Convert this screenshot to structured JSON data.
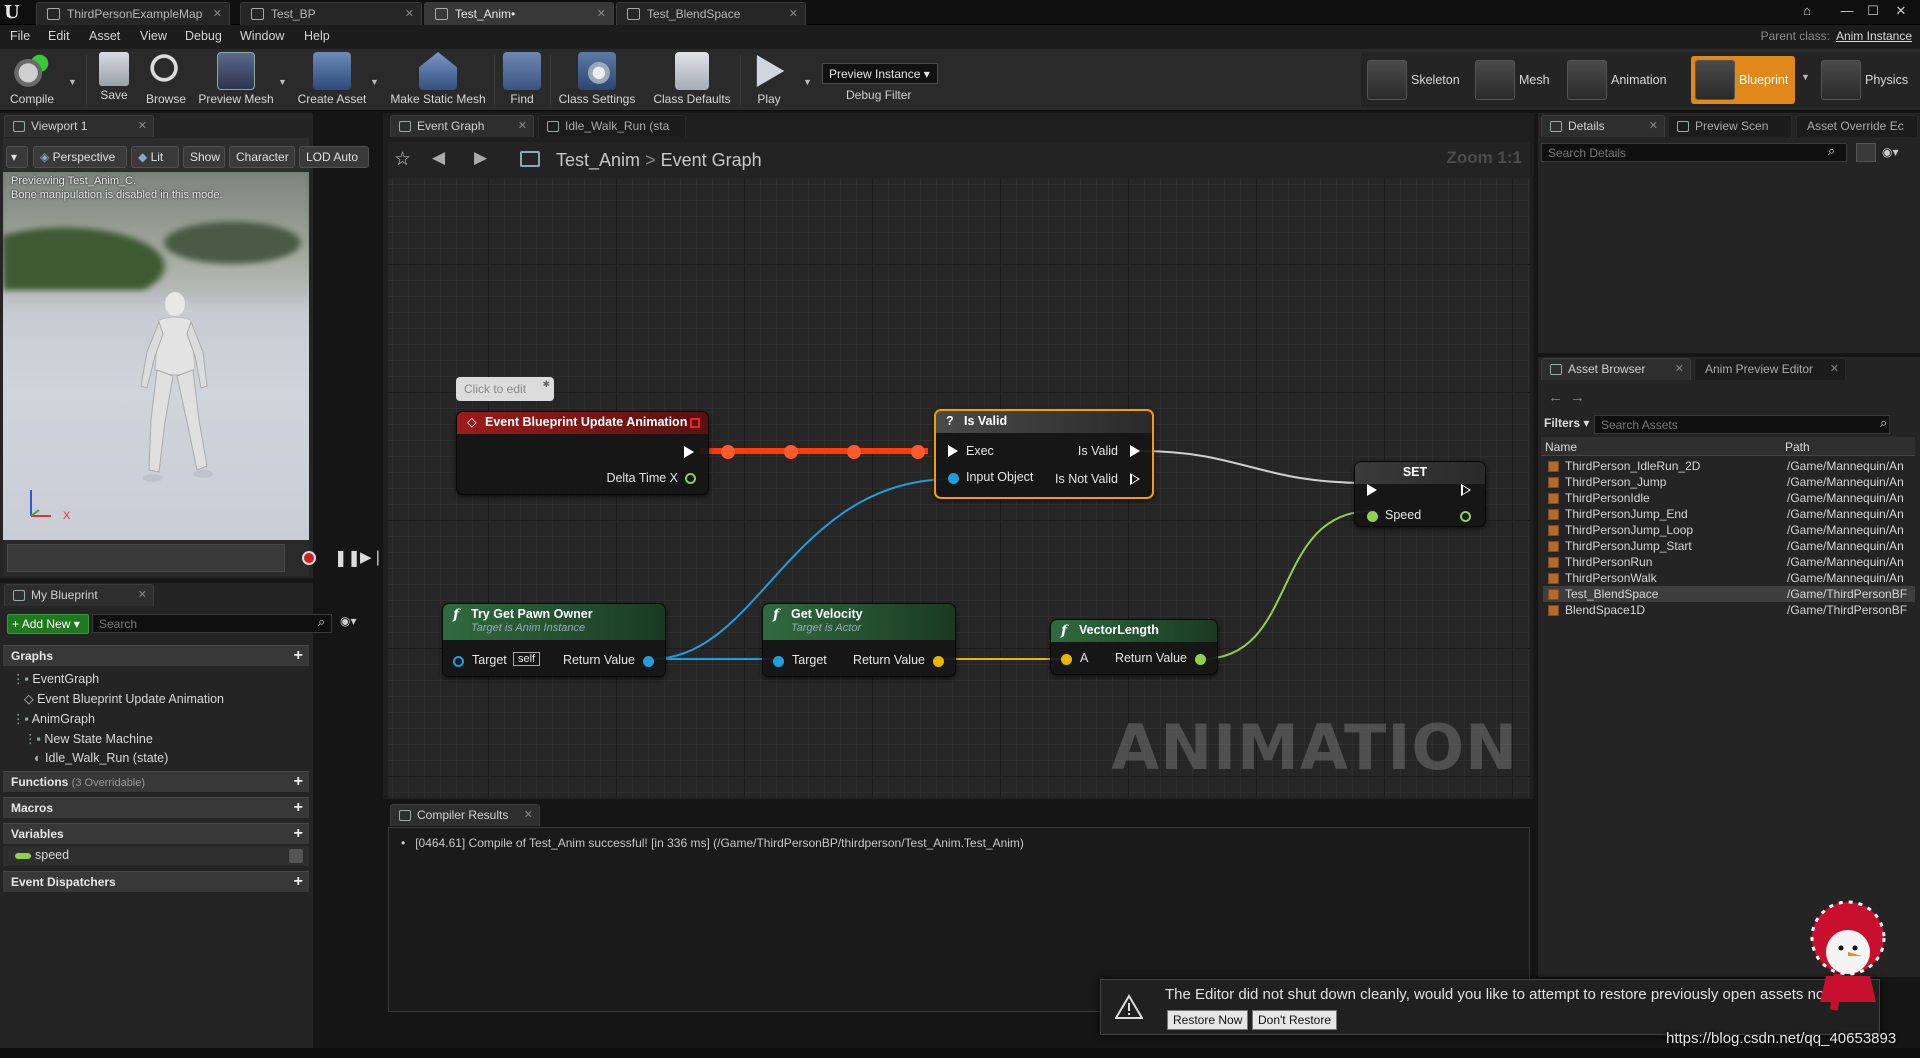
{
  "titlebar": {
    "tabs": [
      "ThirdPersonExampleMap",
      "Test_BP",
      "Test_Anim•",
      "Test_BlendSpace"
    ]
  },
  "menu": {
    "items": [
      "File",
      "Edit",
      "Asset",
      "View",
      "Debug",
      "Window",
      "Help"
    ],
    "parent_class_label": "Parent class:",
    "parent_class_value": "Anim Instance"
  },
  "toolbar": {
    "compile": "Compile",
    "save": "Save",
    "browse": "Browse",
    "preview_mesh": "Preview Mesh",
    "create_asset": "Create Asset",
    "make_static_mesh": "Make Static Mesh",
    "find": "Find",
    "class_settings": "Class Settings",
    "class_defaults": "Class Defaults",
    "play": "Play",
    "preview_instance": "Preview Instance",
    "debug_filter": "Debug Filter",
    "modes": [
      "Skeleton",
      "Mesh",
      "Animation",
      "Blueprint",
      "Physics"
    ]
  },
  "viewport": {
    "tab": "Viewport 1",
    "buttons": [
      "Perspective",
      "Lit",
      "Show",
      "Character",
      "LOD Auto"
    ],
    "line1": "Previewing Test_Anim_C.",
    "line2": "Bone manipulation is disabled in this mode.",
    "axis_x": "X"
  },
  "my_blueprint": {
    "tab": "My Blueprint",
    "add_new": "Add New",
    "search_placeholder": "Search",
    "graphs_label": "Graphs",
    "graph_items": [
      "EventGraph",
      "Event Blueprint Update Animation",
      "AnimGraph",
      "New State Machine",
      "Idle_Walk_Run (state)"
    ],
    "functions_label": "Functions",
    "functions_note": "(3 Overridable)",
    "macros_label": "Macros",
    "variables_label": "Variables",
    "variable": "speed",
    "dispatchers_label": "Event Dispatchers"
  },
  "graph": {
    "tabs": [
      "Event Graph",
      "Idle_Walk_Run (sta"
    ],
    "breadcrumb_root": "Test_Anim",
    "breadcrumb_current": "Event Graph",
    "zoom": "Zoom 1:1",
    "watermark": "ANIMATION",
    "comment_bubble": "Click to edit",
    "nodes": {
      "event": {
        "title": "Event Blueprint Update Animation",
        "pin": "Delta Time X"
      },
      "isvalid": {
        "title": "Is Valid",
        "exec": "Exec",
        "input": "Input Object",
        "valid": "Is Valid",
        "not_valid": "Is Not Valid"
      },
      "set": {
        "title": "SET",
        "pin": "Speed"
      },
      "pawn": {
        "title": "Try Get Pawn Owner",
        "sub": "Target is Anim Instance",
        "target": "Target",
        "self": "self",
        "ret": "Return Value"
      },
      "velocity": {
        "title": "Get Velocity",
        "sub": "Target is Actor",
        "target": "Target",
        "ret": "Return Value"
      },
      "vlen": {
        "title": "VectorLength",
        "a": "A",
        "ret": "Return Value"
      }
    }
  },
  "details": {
    "tabs": [
      "Details",
      "Preview Scen",
      "Asset Override Ec"
    ],
    "search_placeholder": "Search Details"
  },
  "asset_browser": {
    "tabs": [
      "Asset Browser",
      "Anim Preview Editor"
    ],
    "filters": "Filters",
    "search_placeholder": "Search Assets",
    "col_name": "Name",
    "col_path": "Path",
    "rows": [
      {
        "name": "ThirdPerson_IdleRun_2D",
        "path": "/Game/Mannequin/An"
      },
      {
        "name": "ThirdPerson_Jump",
        "path": "/Game/Mannequin/An"
      },
      {
        "name": "ThirdPersonIdle",
        "path": "/Game/Mannequin/An"
      },
      {
        "name": "ThirdPersonJump_End",
        "path": "/Game/Mannequin/An"
      },
      {
        "name": "ThirdPersonJump_Loop",
        "path": "/Game/Mannequin/An"
      },
      {
        "name": "ThirdPersonJump_Start",
        "path": "/Game/Mannequin/An"
      },
      {
        "name": "ThirdPersonRun",
        "path": "/Game/Mannequin/An"
      },
      {
        "name": "ThirdPersonWalk",
        "path": "/Game/Mannequin/An"
      },
      {
        "name": "Test_BlendSpace",
        "path": "/Game/ThirdPersonBF"
      },
      {
        "name": "BlendSpace1D",
        "path": "/Game/ThirdPersonBF"
      }
    ]
  },
  "compiler": {
    "tab": "Compiler Results",
    "message": "[0464.61] Compile of Test_Anim successful! [in 336 ms] (/Game/ThirdPersonBP/thirdperson/Test_Anim.Test_Anim)"
  },
  "notification": {
    "text": "The Editor did not shut down cleanly, would you like to attempt to restore previously open assets now?",
    "restore": "Restore Now",
    "dont_restore": "Don't Restore"
  },
  "watermark_url": "https://blog.csdn.net/qq_40653893"
}
